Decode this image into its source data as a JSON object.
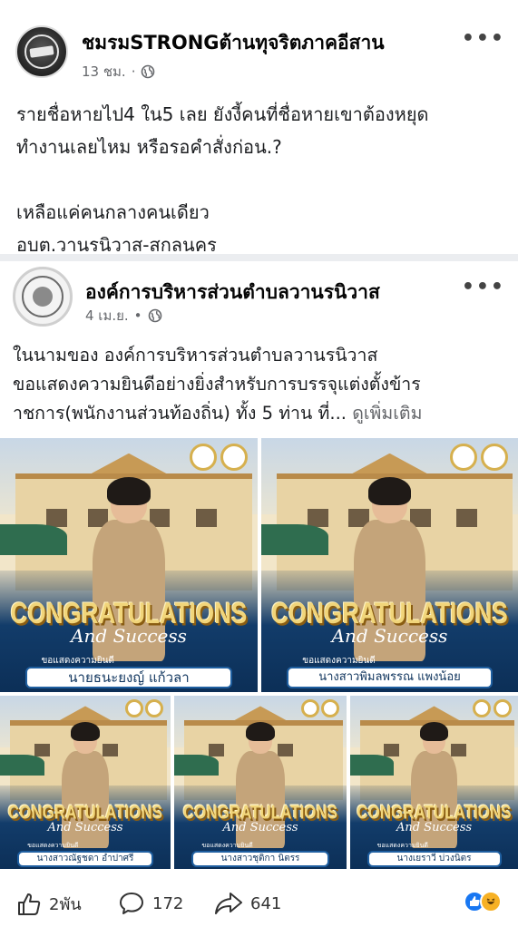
{
  "post": {
    "author": "ชมรมSTRONGต้านทุจริตภาคอีสาน",
    "timestamp": "13 ชม.",
    "separator": "·",
    "more": "•••",
    "lines": [
      "รายชื่อหายไป4 ใน5 เลย ยังงี้คนที่ชื่อหายเขาต้องหยุด",
      "ทำงานเลยไหม หรือรอคำสั่งก่อน.?",
      "",
      "เหลือแค่คนกลางคนเดียว",
      "อบต.วานรนิวาส-สกลนคร"
    ]
  },
  "shared_post": {
    "author": "องค์การบริหารส่วนตำบลวานรนิวาส",
    "timestamp": "4 เม.ย.",
    "separator": "•",
    "more": "•••",
    "lines": [
      "ในนามของ องค์การบริหารส่วนตำบลวานรนิวาส",
      "ขอแสดงความยินดีอย่างยิ่งสำหรับการบรรจุแต่งตั้งข้าร",
      "าชการ(พนักงานส่วนท้องถิ่น) ทั้ง 5 ท่าน ที่..."
    ],
    "see_more": "ดูเพิ่มเติม",
    "photos": [
      {
        "congrats": "CONGRATULATIONS",
        "success": "And Success",
        "caption": "ขอแสดงความยินดี",
        "name": "นายธนะยงญ์ แก้วลา"
      },
      {
        "congrats": "CONGRATULATIONS",
        "success": "And Success",
        "caption": "ขอแสดงความยินดี",
        "name": "นางสาวพิมลพรรณ แพงน้อย"
      },
      {
        "congrats": "CONGRATULATIONS",
        "success": "And Success",
        "caption": "ขอแสดงความยินดี",
        "name": "นางสาวณัฐชดา อำปาศรี"
      },
      {
        "congrats": "CONGRATULATIONS",
        "success": "And Success",
        "caption": "ขอแสดงความยินดี",
        "name": "นางสาวชุติกา นิตรร"
      },
      {
        "congrats": "CONGRATULATIONS",
        "success": "And Success",
        "caption": "ขอแสดงความยินดี",
        "name": "นางเยราวี บ่วงนิตร"
      }
    ]
  },
  "actions": {
    "likes": "2พัน",
    "comments": "172",
    "shares": "641"
  },
  "icons": {
    "globe": "globe-icon",
    "like": "thumbs-up-icon",
    "comment": "comment-icon",
    "share": "share-icon"
  },
  "colors": {
    "accent": "#1877f2",
    "banner_blue": "#123c6a",
    "gold": "#f1d57a"
  }
}
